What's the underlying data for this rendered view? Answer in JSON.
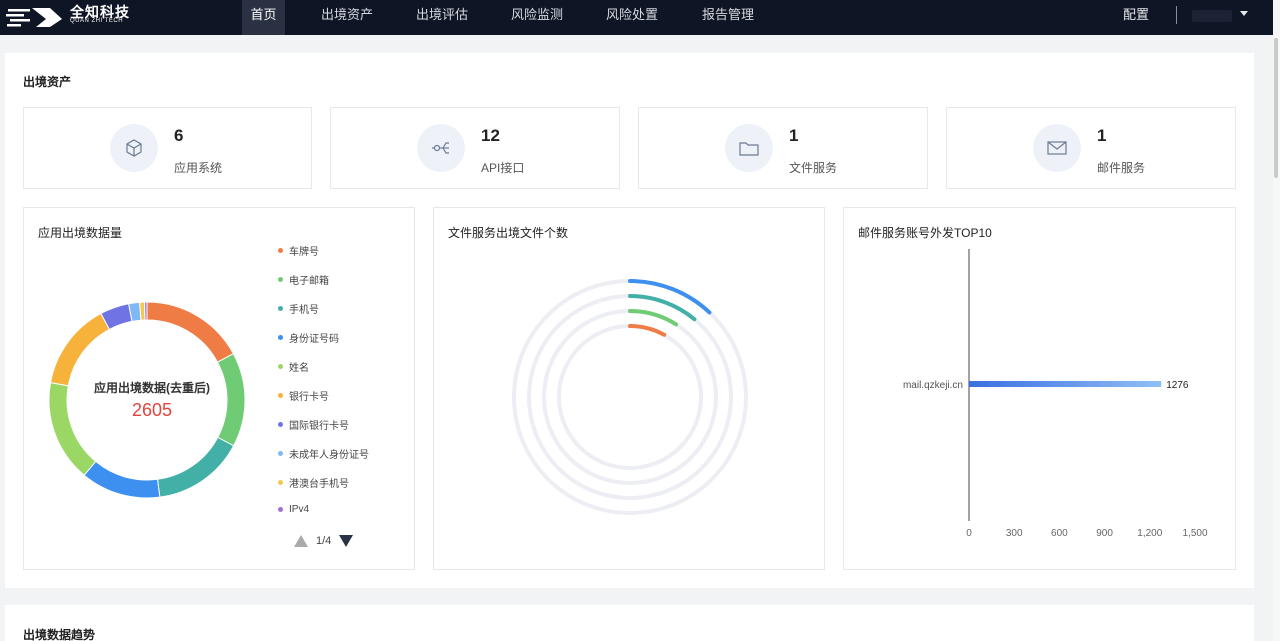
{
  "brand": {
    "name": "全知科技",
    "sub": "QUAN ZHI TECH"
  },
  "nav": [
    {
      "label": "首页"
    },
    {
      "label": "出境资产"
    },
    {
      "label": "出境评估"
    },
    {
      "label": "风险监测"
    },
    {
      "label": "风险处置"
    },
    {
      "label": "报告管理"
    }
  ],
  "config_label": "配置",
  "assets_section": {
    "title": "出境资产"
  },
  "stats": [
    {
      "value": "6",
      "label": "应用系统",
      "icon": "cube-icon"
    },
    {
      "value": "12",
      "label": "API接口",
      "icon": "api-icon"
    },
    {
      "value": "1",
      "label": "文件服务",
      "icon": "folder-icon"
    },
    {
      "value": "1",
      "label": "邮件服务",
      "icon": "mail-icon"
    }
  ],
  "donut_card": {
    "title": "应用出境数据量",
    "center_label": "应用出境数据(去重后)",
    "center_value": "2605",
    "legend": [
      {
        "label": "车牌号",
        "color": "#f07c45"
      },
      {
        "label": "电子邮箱",
        "color": "#6fcc74"
      },
      {
        "label": "手机号",
        "color": "#43b0a8"
      },
      {
        "label": "身份证号码",
        "color": "#3d8ff0"
      },
      {
        "label": "姓名",
        "color": "#9bd764"
      },
      {
        "label": "银行卡号",
        "color": "#f6b23a"
      },
      {
        "label": "国际银行卡号",
        "color": "#6f73e4"
      },
      {
        "label": "未成年人身份证号",
        "color": "#7fb8f2"
      },
      {
        "label": "港澳台手机号",
        "color": "#f2c94c"
      },
      {
        "label": "IPv4",
        "color": "#a36ed6"
      }
    ],
    "pager": "1/4"
  },
  "file_card": {
    "title": "文件服务出境文件个数"
  },
  "mail_card": {
    "title": "邮件服务账号外发TOP10",
    "ticks": [
      "0",
      "300",
      "600",
      "900",
      "1,200",
      "1,500"
    ]
  },
  "trend_section": {
    "title": "出境数据趋势"
  },
  "colors": {
    "topbar": "#0e1525",
    "accent_red": "#e0443c"
  },
  "chart_data": [
    {
      "type": "pie",
      "title": "应用出境数据量",
      "categories": [
        "车牌号",
        "电子邮箱",
        "手机号",
        "身份证号码",
        "姓名",
        "银行卡号",
        "国际银行卡号",
        "未成年人身份证号",
        "港澳台手机号",
        "IPv4"
      ],
      "values": [
        430,
        390,
        380,
        330,
        420,
        360,
        120,
        45,
        20,
        10
      ],
      "total": 2605
    },
    {
      "type": "bar",
      "title": "文件服务出境文件个数",
      "series": [
        {
          "value": 0.12,
          "color": "#3d8ff0"
        },
        {
          "value": 0.11,
          "color": "#43b0a8"
        },
        {
          "value": 0.09,
          "color": "#6fcc74"
        },
        {
          "value": 0.08,
          "color": "#f07c45"
        }
      ]
    },
    {
      "type": "bar",
      "title": "邮件服务账号外发TOP10",
      "categories": [
        "mail.qzkeji.cn"
      ],
      "values": [
        1276
      ],
      "xlim": [
        0,
        1500
      ],
      "xticks": [
        0,
        300,
        600,
        900,
        1200,
        1500
      ]
    }
  ]
}
